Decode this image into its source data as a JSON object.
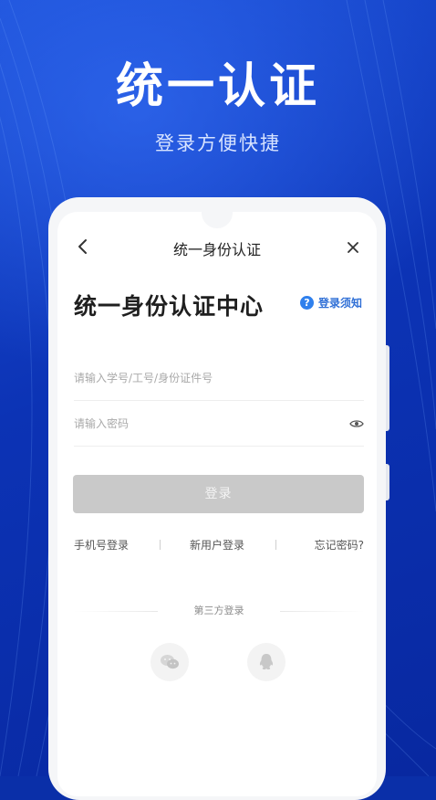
{
  "hero": {
    "title": "统一认证",
    "subtitle": "登录方便快捷"
  },
  "nav": {
    "title": "统一身份认证",
    "back_icon": "chevron-left-icon",
    "close_icon": "close-icon"
  },
  "main": {
    "heading": "统一身份认证中心",
    "notice_label": "登录须知",
    "notice_icon_glyph": "?"
  },
  "form": {
    "username_placeholder": "请输入学号/工号/身份证件号",
    "password_placeholder": "请输入密码",
    "login_label": "登录"
  },
  "links": {
    "phone_login": "手机号登录",
    "new_user": "新用户登录",
    "forgot": "忘记密码?"
  },
  "third_party": {
    "label": "第三方登录",
    "providers": [
      "wechat-icon",
      "qq-icon"
    ]
  },
  "colors": {
    "background": "#0a2fa8",
    "accent_blue": "#2f80ed",
    "button_disabled": "#c9c9c9"
  }
}
